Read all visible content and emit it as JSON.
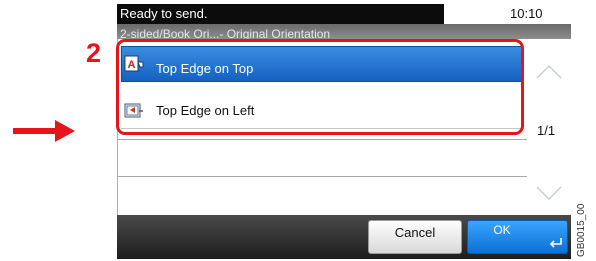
{
  "status": {
    "message": "Ready to send.",
    "time": "10:10"
  },
  "breadcrumb": {
    "text": "2-sided/Book Ori...- Original Orientation"
  },
  "options": [
    {
      "label": "Top Edge on Top",
      "icon": "top-edge-on-top-icon",
      "selected": true
    },
    {
      "label": "Top Edge on Left",
      "icon": "top-edge-on-left-icon",
      "selected": false
    }
  ],
  "pagination": {
    "indicator": "1/1"
  },
  "buttons": {
    "cancel": "Cancel",
    "ok": "OK"
  },
  "annotation": {
    "step": "2"
  },
  "figure_code": "GB0015_00",
  "colors": {
    "accent_blue": "#1f73d2",
    "highlight_red": "#e8141c",
    "status_bg": "#0c0c0c"
  }
}
